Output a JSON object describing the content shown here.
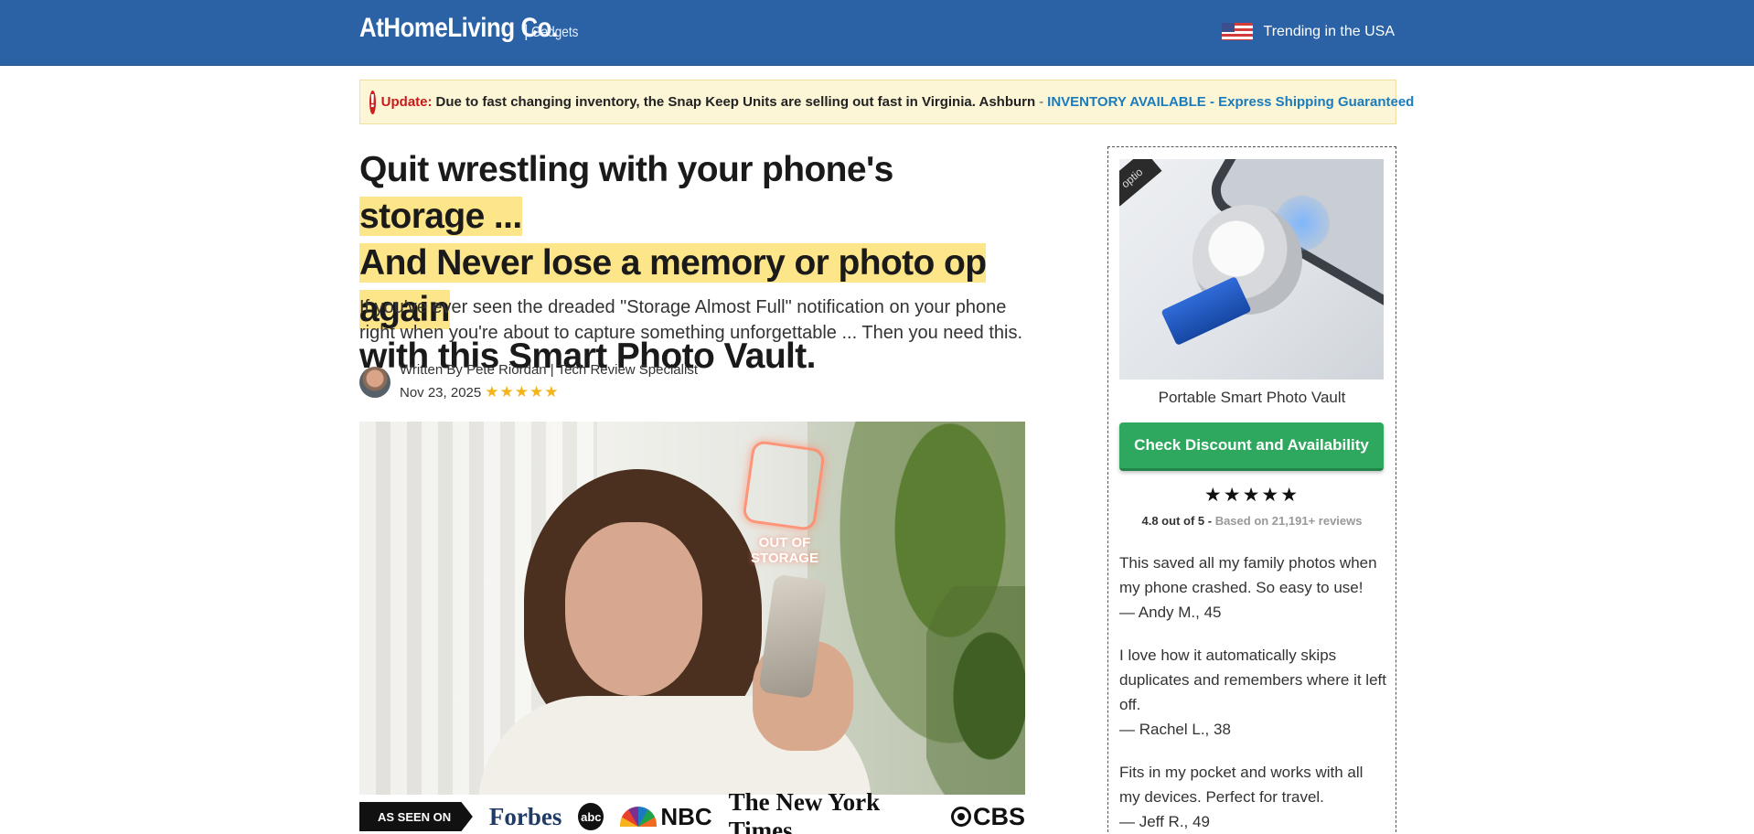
{
  "header": {
    "brand": "AtHomeLiving Co.",
    "brand_separator": "|",
    "brand_sub": "Gadgets",
    "trend_text": "Trending in the USA",
    "bg_color": "#2b62a6"
  },
  "alert": {
    "icon": "!",
    "label": "Update:",
    "text": "Due to fast changing inventory, the Snap Keep Units are selling out fast in Virginia. Ashburn",
    "dash": "-",
    "link_text": "INVENTORY AVAILABLE - Express Shipping Guaranteed"
  },
  "article": {
    "headline_part1": "Quit wrestling with your phone's ",
    "headline_highlight1": "storage ...",
    "headline_highlight2": "And Never lose a memory or photo op again",
    "headline_part3": "with this Smart Photo Vault.",
    "subhead": "If you've ever seen the dreaded \"Storage Almost Full\" notification on your phone right when you're about to capture something unforgettable ... Then you need this.",
    "author_line": "Written By Pete Riordan | Tech Review Specialist",
    "date": "Nov 23, 2025",
    "stars": "★★★★★",
    "hero_overlay": "OUT OF STORAGE"
  },
  "as_seen_on": {
    "label": "AS SEEN ON",
    "logos": {
      "forbes": "Forbes",
      "abc": "abc",
      "nbc": "NBC",
      "nyt": "The New York Times",
      "cbs": "CBS"
    }
  },
  "sidebar": {
    "corner_tag": "optio",
    "product_title": "Portable Smart Photo Vault",
    "cta_label": "Check Discount and Availability",
    "cta_color": "#2fa85f",
    "stars": "★★★★★",
    "rating_score": "4.8 out of 5 -",
    "rating_count": "Based on 21,191+ reviews",
    "testimonials": [
      {
        "text": "This saved all my family photos when my phone crashed. So easy to use!",
        "author": "— Andy M., 45"
      },
      {
        "text": "I love how it automatically skips duplicates and remembers where it left off.",
        "author": "— Rachel L., 38"
      },
      {
        "text": "Fits in my pocket and works with all my devices. Perfect for travel.",
        "author": "— Jeff R., 49"
      }
    ]
  }
}
